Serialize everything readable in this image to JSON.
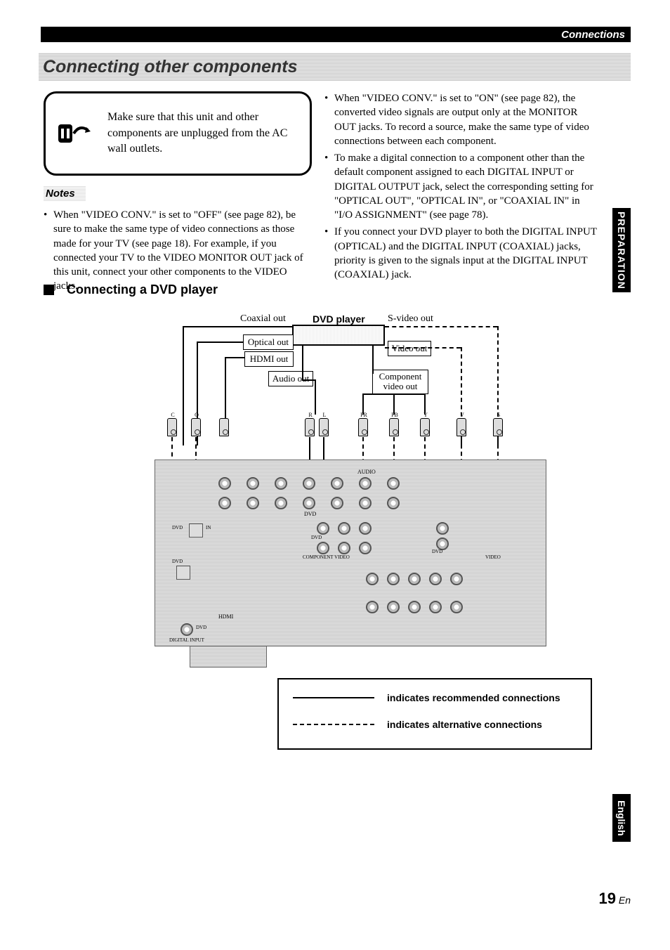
{
  "header": {
    "section": "Connections"
  },
  "title": "Connecting other components",
  "warning": {
    "text": "Make sure that this unit and other components are unplugged from the AC wall outlets."
  },
  "notes": {
    "label": "Notes",
    "left": [
      "When \"VIDEO CONV.\" is set to \"OFF\" (see page 82), be sure to make the same type of video connections as those made for your TV (see page 18). For example, if you connected your TV to the VIDEO MONITOR OUT jack of this unit, connect your other components to the VIDEO jacks."
    ],
    "right": [
      "When \"VIDEO CONV.\" is set to \"ON\" (see page 82), the converted video signals are output only at the MONITOR OUT jacks. To record a source, make the same type of video connections between each component.",
      "To make a digital connection to a component other than the default component assigned to each DIGITAL INPUT or DIGITAL OUTPUT jack, select the corresponding setting for \"OPTICAL OUT\", \"OPTICAL IN\", or \"COAXIAL IN\" in \"I/O ASSIGNMENT\" (see page 78).",
      "If you connect your DVD player to both the DIGITAL INPUT (OPTICAL) and the DIGITAL INPUT (COAXIAL) jacks, priority is given to the signals input at the DIGITAL INPUT (COAXIAL) jack."
    ]
  },
  "section": {
    "heading": "Connecting a DVD player"
  },
  "diagram": {
    "device": "DVD player",
    "labels": {
      "coaxial_out": "Coaxial out",
      "optical_out": "Optical out",
      "hdmi_out": "HDMI out",
      "audio_out": "Audio out",
      "svideo_out": "S-video out",
      "video_out": "Video out",
      "component_video_out": "Component video out"
    },
    "connector_letters": [
      "C",
      "O",
      "R",
      "L",
      "PR",
      "PB",
      "Y",
      "V",
      "S"
    ],
    "panel_text": {
      "audio": "AUDIO",
      "dvd": "DVD",
      "component_video": "COMPONENT VIDEO",
      "video": "VIDEO",
      "hdmi": "HDMI",
      "digital_input": "DIGITAL INPUT",
      "in": "IN"
    }
  },
  "legend": {
    "solid": "indicates recommended connections",
    "dashed": "indicates alternative connections"
  },
  "sidebar": {
    "preparation": "PREPARATION",
    "language": "English"
  },
  "page": {
    "number": "19",
    "suffix": "En"
  }
}
